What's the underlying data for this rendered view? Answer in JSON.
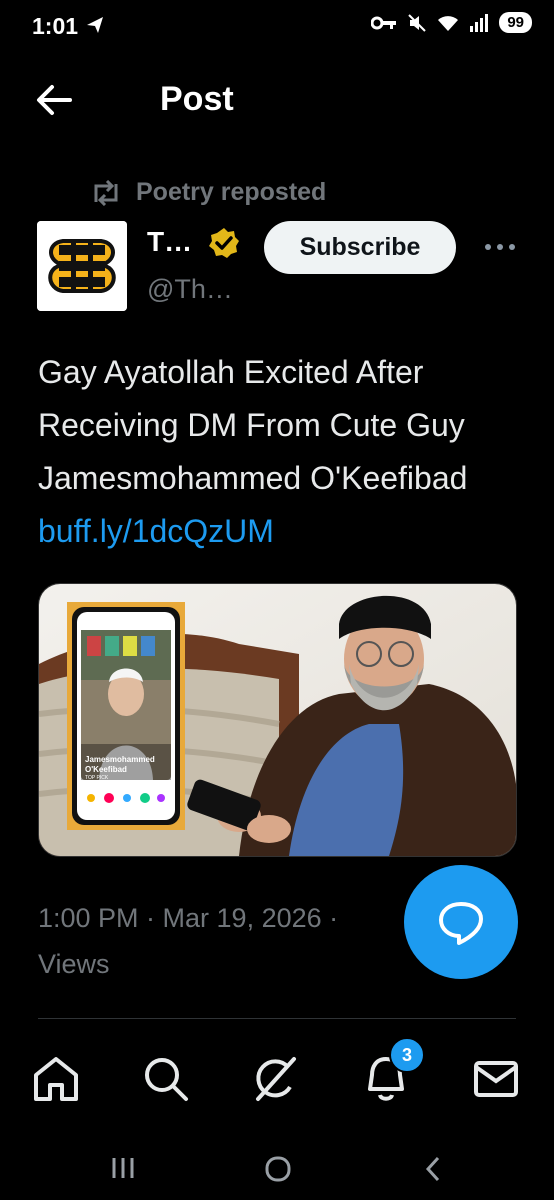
{
  "status_bar": {
    "time": "1:01",
    "battery": "99"
  },
  "header": {
    "title": "Post"
  },
  "repost": {
    "label": "Poetry reposted"
  },
  "author": {
    "name": "T…",
    "handle": "@Th…"
  },
  "subscribe_label": "Subscribe",
  "tweet": {
    "text": "Gay Ayatollah Excited After Receiving DM From Cute Guy Jamesmohammed O'Keefibad ",
    "link": "buff.ly/1dcQzUM"
  },
  "media": {
    "profile_name_line1": "Jamesmohammed",
    "profile_name_line2": "O'Keefibad",
    "top_pick": "TOP PICK"
  },
  "meta": {
    "timestamp": "1:00 PM · Mar 19, 2026 · ",
    "views_label": "Views"
  },
  "nav": {
    "notifications_badge": "3"
  },
  "colors": {
    "accent": "#1d9bf0",
    "background": "#000000",
    "muted": "#71767b"
  },
  "icons": [
    "back-arrow-icon",
    "repost-icon",
    "verified-badge-icon",
    "more-icon",
    "reply-icon",
    "home-icon",
    "search-icon",
    "grok-icon",
    "notifications-icon",
    "mail-icon"
  ]
}
